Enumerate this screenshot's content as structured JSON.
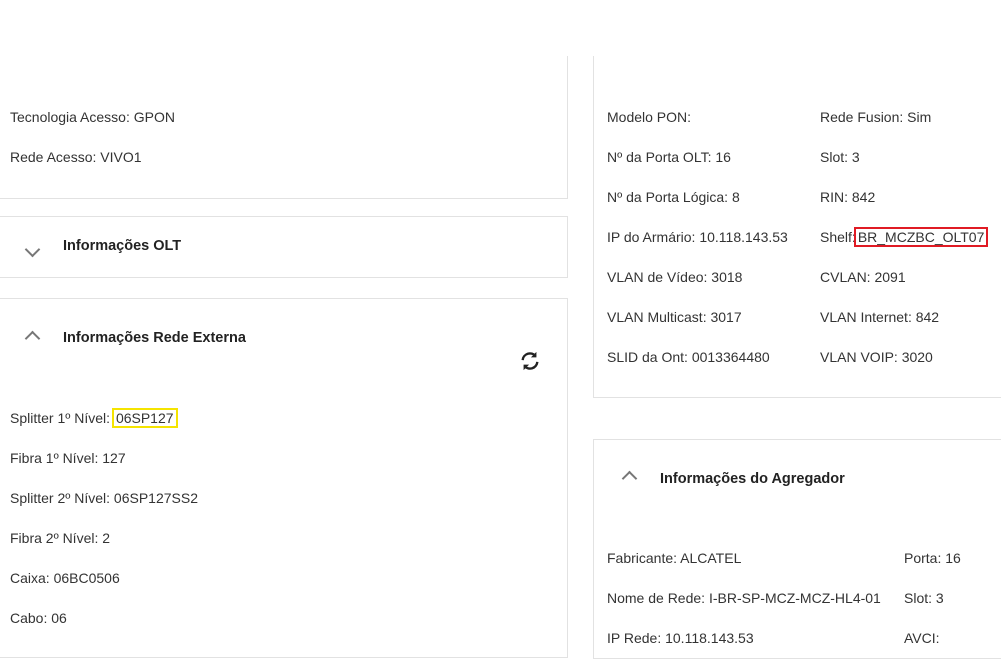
{
  "acesso": {
    "tecnologia": "Tecnologia Acesso: GPON",
    "rede": "Rede Acesso: VIVO1"
  },
  "olt": {
    "title": "Informações OLT"
  },
  "rede_externa": {
    "title": "Informações Rede Externa",
    "splitter1_label": "Splitter 1º Nível: ",
    "splitter1_value": "06SP127",
    "fibra1": "Fibra 1º Nível: 127",
    "splitter2": "Splitter 2º Nível: 06SP127SS2",
    "fibra2": "Fibra 2º Nível: 2",
    "caixa": "Caixa: 06BC0506",
    "cabo": "Cabo: 06"
  },
  "pon": {
    "col1": [
      "Modelo PON:",
      "Nº da Porta OLT: 16",
      "Nº da Porta Lógica: 8",
      "IP do Armário: 10.118.143.53",
      "VLAN de Vídeo: 3018",
      "VLAN Multicast: 3017",
      "SLID da Ont: 0013364480"
    ],
    "col2": [
      "Rede Fusion: Sim",
      "Slot: 3",
      "RIN: 842"
    ],
    "shelf_label": "Shelf:",
    "shelf_value": "BR_MCZBC_OLT07",
    "col2b": [
      "CVLAN: 2091",
      "VLAN Internet: 842",
      "VLAN VOIP: 3020"
    ]
  },
  "agregador": {
    "title": "Informações do Agregador",
    "col1": [
      "Fabricante: ALCATEL",
      "Nome de Rede: I-BR-SP-MCZ-MCZ-HL4-01",
      "IP Rede: 10.118.143.53"
    ],
    "col2": [
      "Porta: 16",
      "Slot: 3",
      "AVCI:"
    ]
  }
}
